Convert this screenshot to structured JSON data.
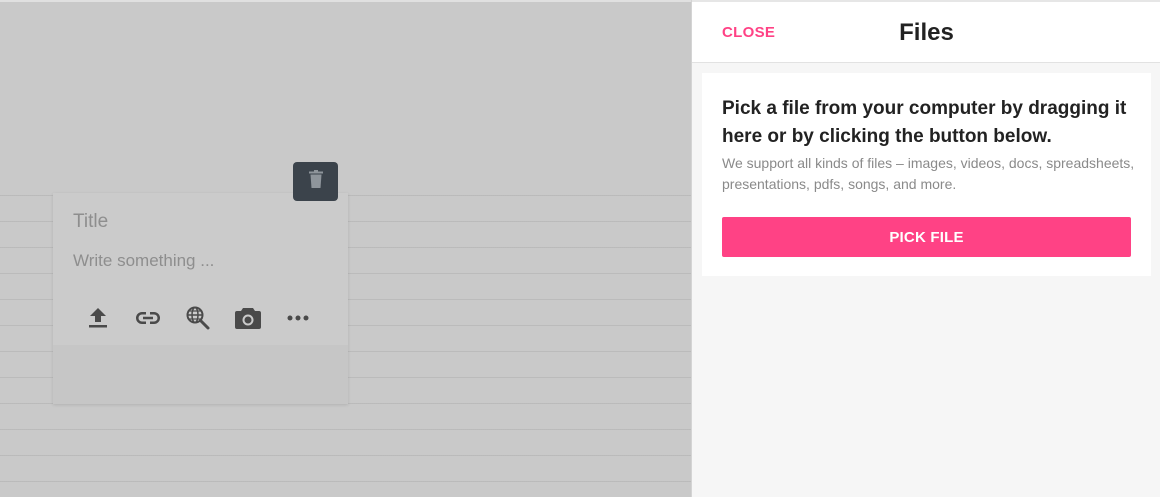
{
  "note": {
    "title_placeholder": "Title",
    "body_placeholder": "Write something ...",
    "tools": [
      "upload-icon",
      "link-icon",
      "web-search-icon",
      "camera-icon",
      "more-icon"
    ],
    "delete_icon": "trash-icon"
  },
  "panel": {
    "close_label": "CLOSE",
    "title": "Files",
    "heading": "Pick a file from your computer by dragging it here or by clicking the button below.",
    "subtext": "We support all kinds of files – images, videos, docs, spreadsheets, presentations, pdfs, songs, and more.",
    "pick_button_label": "PICK FILE"
  },
  "colors": {
    "accent": "#ff4285",
    "trash_button": "#3b434b",
    "overlay": "#c9c9c9"
  }
}
